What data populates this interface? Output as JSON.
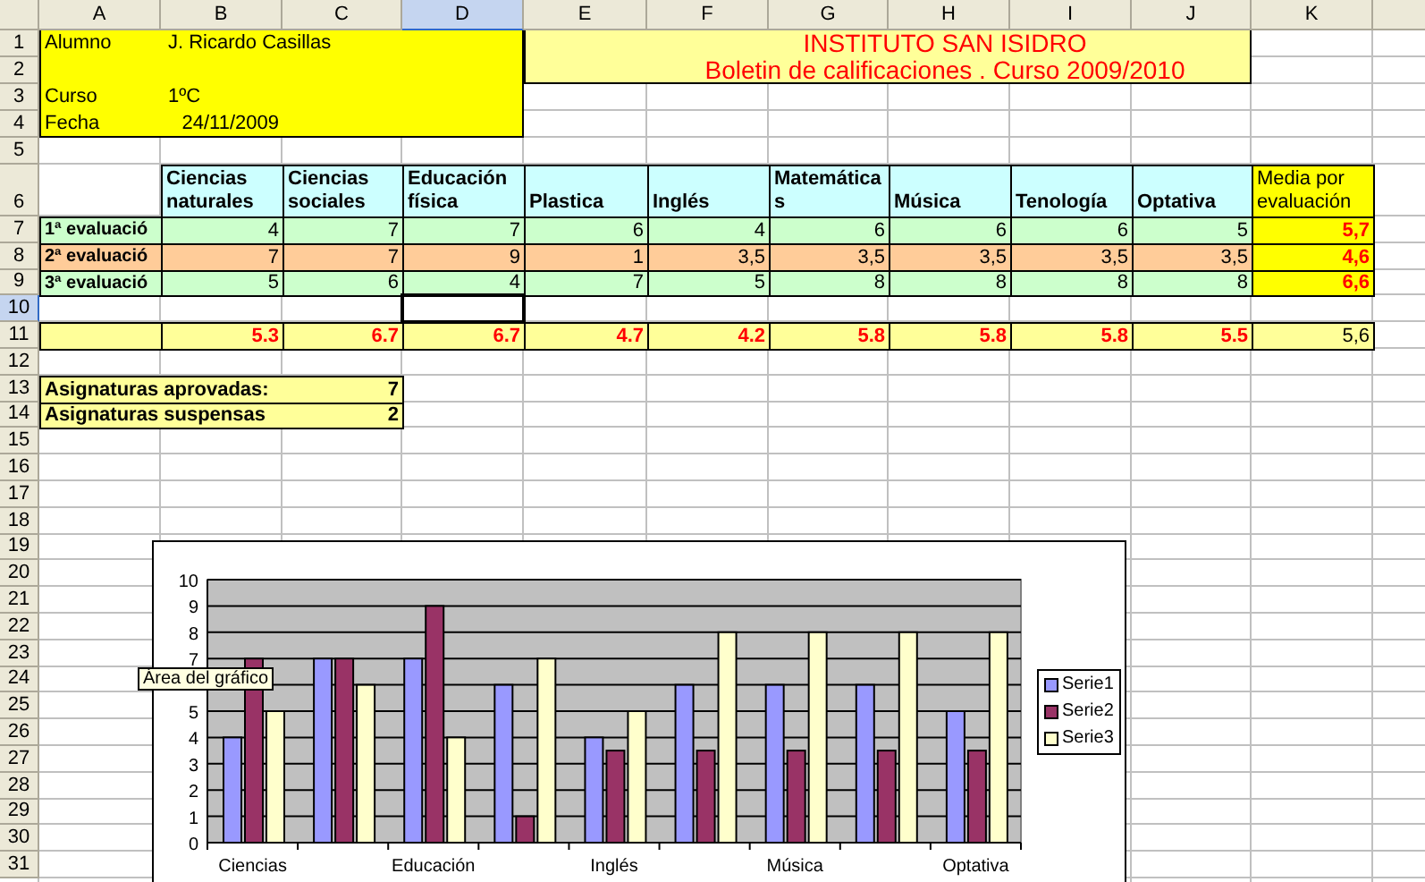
{
  "column_headers": [
    {
      "label": "A",
      "selected": false
    },
    {
      "label": "B",
      "selected": false
    },
    {
      "label": "C",
      "selected": false
    },
    {
      "label": "D",
      "selected": true
    },
    {
      "label": "E",
      "selected": false
    },
    {
      "label": "F",
      "selected": false
    },
    {
      "label": "G",
      "selected": false
    },
    {
      "label": "H",
      "selected": false
    },
    {
      "label": "I",
      "selected": false
    },
    {
      "label": "J",
      "selected": false
    },
    {
      "label": "K",
      "selected": false
    }
  ],
  "row_headers": [
    {
      "label": "1",
      "selected": false
    },
    {
      "label": "2",
      "selected": false
    },
    {
      "label": "3",
      "selected": false
    },
    {
      "label": "4",
      "selected": false
    },
    {
      "label": "5",
      "selected": false
    },
    {
      "label": "6",
      "selected": false
    },
    {
      "label": "7",
      "selected": false
    },
    {
      "label": "8",
      "selected": false
    },
    {
      "label": "9",
      "selected": false
    },
    {
      "label": "10",
      "selected": true
    },
    {
      "label": "11",
      "selected": false
    },
    {
      "label": "12",
      "selected": false
    },
    {
      "label": "13",
      "selected": false
    },
    {
      "label": "14",
      "selected": false
    },
    {
      "label": "15",
      "selected": false
    },
    {
      "label": "16",
      "selected": false
    },
    {
      "label": "17",
      "selected": false
    },
    {
      "label": "18",
      "selected": false
    },
    {
      "label": "19",
      "selected": false
    },
    {
      "label": "20",
      "selected": false
    },
    {
      "label": "21",
      "selected": false
    },
    {
      "label": "22",
      "selected": false
    },
    {
      "label": "23",
      "selected": false
    },
    {
      "label": "24",
      "selected": false
    },
    {
      "label": "25",
      "selected": false
    },
    {
      "label": "26",
      "selected": false
    },
    {
      "label": "27",
      "selected": false
    },
    {
      "label": "28",
      "selected": false
    },
    {
      "label": "29",
      "selected": false
    },
    {
      "label": "30",
      "selected": false
    },
    {
      "label": "31",
      "selected": false
    }
  ],
  "student_block": [
    {
      "label": "Alumno",
      "value": "J. Ricardo Casillas",
      "kind": "text"
    },
    {
      "label": "Curso",
      "value": "1ºC",
      "kind": "text"
    },
    {
      "label": "Fecha",
      "value": "24/11/2009",
      "kind": "date"
    }
  ],
  "title_block": {
    "school": "INSTITUTO SAN ISIDRO",
    "subtitle": "Boletin de calificaciones . Curso 2009/2010"
  },
  "grades_table": {
    "columns": [
      "Ciencias naturales",
      "Ciencias sociales",
      "Educación física",
      "Plastica",
      "Inglés",
      "Matemáticas",
      "Música",
      "Tenología",
      "Optativa"
    ],
    "average_column": "Media por evaluación",
    "rows": [
      {
        "label": "1ª evaluació",
        "color": "#ccffcc",
        "grades": [
          "4",
          "7",
          "7",
          "6",
          "4",
          "6",
          "6",
          "6",
          "5"
        ],
        "average": "5,7"
      },
      {
        "label": "2ª evaluació",
        "color": "#ffcc99",
        "grades": [
          "7",
          "7",
          "9",
          "1",
          "3,5",
          "3,5",
          "3,5",
          "3,5",
          "3,5"
        ],
        "average": "4,6"
      },
      {
        "label": "3ª evaluació",
        "color": "#ccffcc",
        "grades": [
          "5",
          "6",
          "4",
          "7",
          "5",
          "8",
          "8",
          "8",
          "8"
        ],
        "average": "6,6"
      }
    ],
    "subject_averages": [
      "5.3",
      "6.7",
      "6.7",
      "4.7",
      "4.2",
      "5.8",
      "5.8",
      "5.8",
      "5.5"
    ],
    "overall_average": "5,6"
  },
  "summary": [
    {
      "label": "Asignaturas aprovadas:",
      "value": "7"
    },
    {
      "label": "Asignaturas suspensas",
      "value": "2"
    }
  ],
  "chart": {
    "tooltip": "Área del gráfico",
    "chart_data": {
      "type": "bar",
      "ylim": [
        0,
        10
      ],
      "yticks": [
        0,
        1,
        2,
        3,
        4,
        5,
        7,
        8,
        9,
        10
      ],
      "grid": true,
      "legend": true,
      "categories": [
        "Ciencias",
        null,
        "Educación",
        null,
        "Inglés",
        null,
        "Música",
        null,
        "Optativa"
      ],
      "series": [
        {
          "name": "Serie1",
          "color": "#9999ff",
          "values": [
            4,
            7,
            7,
            6,
            4,
            6,
            6,
            6,
            5
          ]
        },
        {
          "name": "Serie2",
          "color": "#993366",
          "values": [
            7,
            7,
            9,
            1,
            3.5,
            3.5,
            3.5,
            3.5,
            3.5
          ]
        },
        {
          "name": "Serie3",
          "color": "#ffffcc",
          "values": [
            5,
            6,
            4,
            7,
            5,
            8,
            8,
            8,
            8
          ]
        }
      ]
    }
  }
}
